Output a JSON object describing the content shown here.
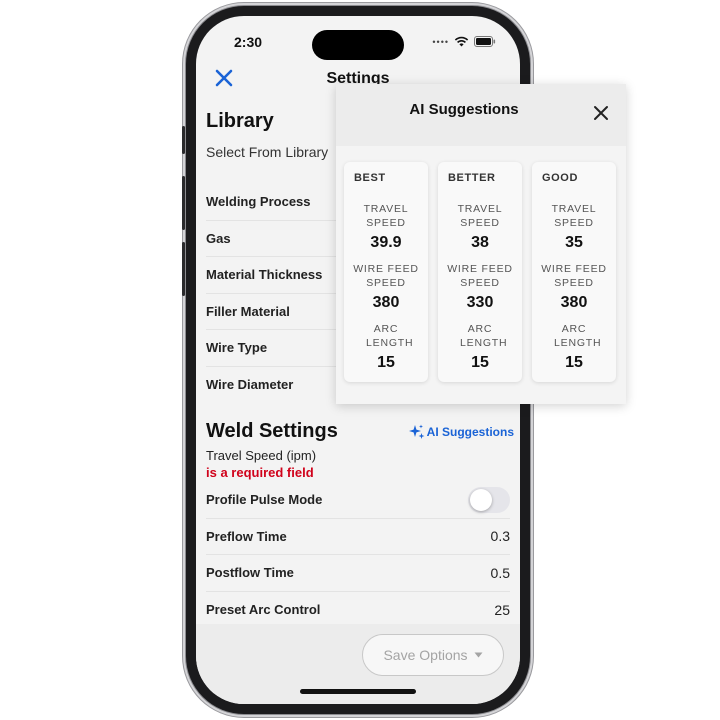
{
  "status_bar": {
    "time": "2:30"
  },
  "nav": {
    "title": "Settings"
  },
  "library": {
    "title": "Library",
    "subtitle": "Select From Library",
    "rows": [
      "Welding Process",
      "Gas",
      "Material Thickness",
      "Filler Material",
      "Wire Type",
      "Wire Diameter"
    ]
  },
  "weld_settings": {
    "title": "Weld Settings",
    "ai_link": "AI Suggestions",
    "travel_label": "Travel Speed (ipm)",
    "required_text": "is a required field",
    "profile_pulse": {
      "label": "Profile Pulse Mode",
      "on": false
    },
    "rows": [
      {
        "label": "Preflow Time",
        "value": "0.3"
      },
      {
        "label": "Postflow Time",
        "value": "0.5"
      },
      {
        "label": "Preset Arc Control",
        "value": "25"
      }
    ]
  },
  "bottom": {
    "save_label": "Save Options"
  },
  "popup": {
    "title": "AI Suggestions",
    "labels": {
      "travel": "TRAVEL SPEED",
      "wire": "WIRE FEED SPEED",
      "arc": "ARC LENGTH"
    },
    "cards": [
      {
        "tier": "BEST",
        "travel": "39.9",
        "wire": "380",
        "arc": "15"
      },
      {
        "tier": "BETTER",
        "travel": "38",
        "wire": "330",
        "arc": "15"
      },
      {
        "tier": "GOOD",
        "travel": "35",
        "wire": "380",
        "arc": "15"
      }
    ]
  },
  "colors": {
    "accent": "#1a63d6",
    "error": "#d0021b"
  }
}
